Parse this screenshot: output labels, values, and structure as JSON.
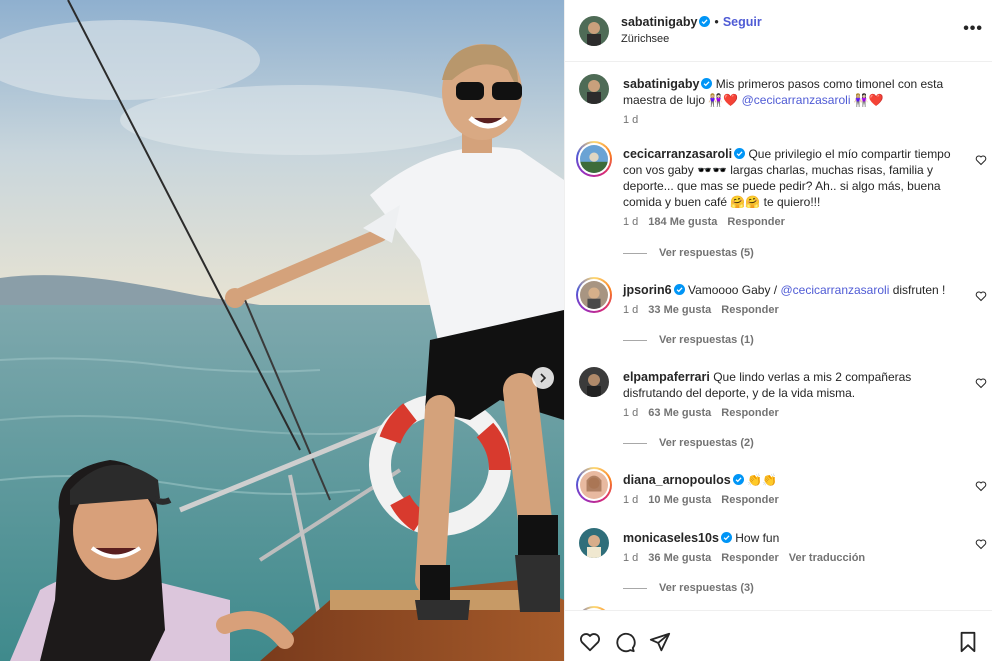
{
  "post": {
    "author": "sabatinigaby",
    "follow_label": "Seguir",
    "separator": "•",
    "location": "Zürichsee",
    "more_label": "•••"
  },
  "caption": {
    "author": "sabatinigaby",
    "text": "Mis primeros pasos como timonel con esta maestra de lujo 👩🏼‍🤝‍👩🏻❤️ ",
    "mention": "@cecicarranzasaroli",
    "text_after": " 👩🏼‍🤝‍👩🏻❤️",
    "time": "1 d"
  },
  "comments": [
    {
      "author": "cecicarranzasaroli",
      "text": "Que privilegio el mío compartir tiempo con vos gaby 🕶️🕶️ largas charlas, muchas risas, familia y deporte... que mas se puede pedir? Ah.. si algo más, buena comida y buen café 🤗🤗 te quiero!!!",
      "time": "1 d",
      "likes": "184 Me gusta",
      "reply": "Responder",
      "view_replies": "Ver respuestas (5)"
    },
    {
      "author": "jpsorin6",
      "text": "Vamoooo Gaby / ",
      "mention": "@cecicarranzasaroli",
      "text_after": " disfruten !",
      "time": "1 d",
      "likes": "33 Me gusta",
      "reply": "Responder",
      "view_replies": "Ver respuestas (1)"
    },
    {
      "author": "elpampaferrari",
      "text": "Que lindo verlas a mis 2 compañeras disfrutando del deporte, y de la vida misma.",
      "time": "1 d",
      "likes": "63 Me gusta",
      "reply": "Responder",
      "view_replies": "Ver respuestas (2)"
    },
    {
      "author": "diana_arnopoulos",
      "text": "👏👏",
      "time": "1 d",
      "likes": "10 Me gusta",
      "reply": "Responder"
    },
    {
      "author": "monicaseles10s",
      "text": "How fun",
      "time": "1 d",
      "likes": "36 Me gusta",
      "reply": "Responder",
      "translate": "Ver traducción",
      "view_replies": "Ver respuestas (3)"
    }
  ],
  "colors": {
    "link": "#4f5bd5",
    "verified": "#0095f6",
    "muted": "#737373",
    "text": "#262626"
  },
  "icons": [
    "verified-badge-icon",
    "heart-icon",
    "comment-icon",
    "share-icon",
    "bookmark-icon",
    "chevron-right-icon",
    "more-icon"
  ]
}
